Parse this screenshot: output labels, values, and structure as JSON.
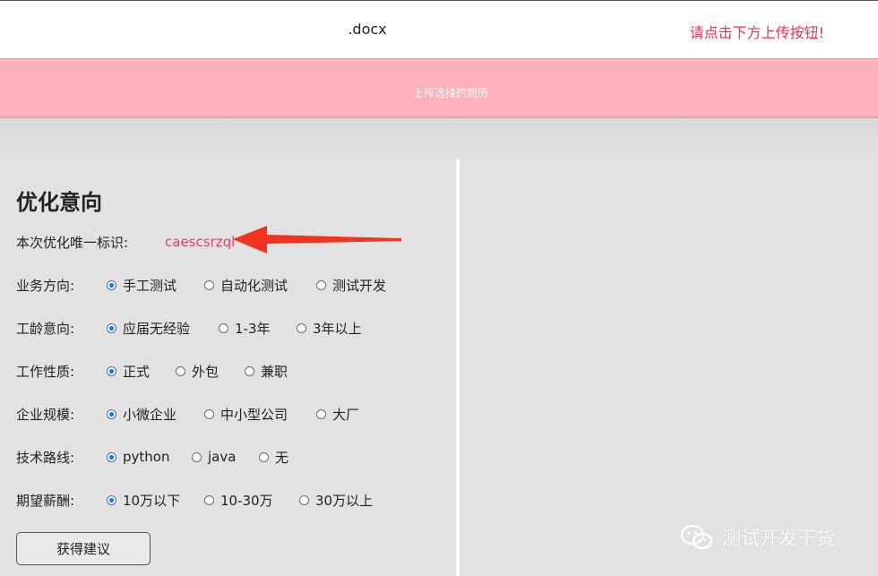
{
  "header": {
    "filename": ".docx",
    "hint": "请点击下方上传按钮!"
  },
  "upload": {
    "label": "上传选择的简历"
  },
  "form": {
    "title": "优化意向",
    "uid_label": "本次优化唯一标识:",
    "uid_value": "caescsrzql",
    "groups": [
      {
        "label": "业务方向:",
        "options": [
          "手工测试",
          "自动化测试",
          "测试开发"
        ],
        "selected": 0
      },
      {
        "label": "工龄意向:",
        "options": [
          "应届无经验",
          "1-3年",
          "3年以上"
        ],
        "selected": 0
      },
      {
        "label": "工作性质:",
        "options": [
          "正式",
          "外包",
          "兼职"
        ],
        "selected": 0
      },
      {
        "label": "企业规模:",
        "options": [
          "小微企业",
          "中小型公司",
          "大厂"
        ],
        "selected": 0
      },
      {
        "label": "技术路线:",
        "options": [
          "python",
          "java",
          "无"
        ],
        "selected": 0
      },
      {
        "label": "期望薪酬:",
        "options": [
          "10万以下",
          "10-30万",
          "30万以上"
        ],
        "selected": 0
      }
    ],
    "submit_label": "获得建议"
  },
  "watermark": {
    "text": "测试开发干货",
    "icon": "wechat-icon"
  },
  "colors": {
    "upload_bar": "#feb0bb",
    "hint_text": "#e8335b",
    "uid_text": "#e0426a",
    "radio_accent": "#1f6ff0",
    "annotation_arrow": "#f0321e"
  }
}
